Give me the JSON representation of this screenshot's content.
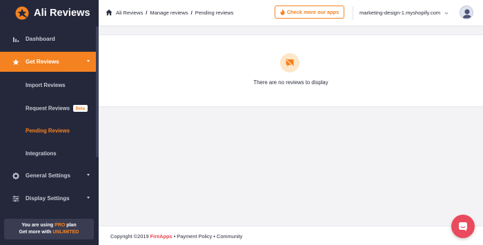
{
  "app": {
    "name": "Ali Reviews"
  },
  "sidebar": {
    "items": [
      {
        "label": "Dashboard"
      },
      {
        "label": "Get Reviews"
      },
      {
        "label": "General Settings"
      },
      {
        "label": "Display Settings"
      }
    ],
    "sub_items": [
      {
        "label": "Import Reviews"
      },
      {
        "label": "Request Reviews",
        "badge": "Beta"
      },
      {
        "label": "Pending Reviews"
      },
      {
        "label": "Integrations"
      }
    ],
    "plan": {
      "line1_prefix": "You are using ",
      "line1_plan": "PRO",
      "line1_suffix": " plan",
      "line2_prefix": "Get more with ",
      "line2_highlight": "UNLIMITED"
    }
  },
  "header": {
    "breadcrumb": [
      "Ali Reviews",
      "Manage reviews",
      "Pending reviews"
    ],
    "separator": "/",
    "check_apps_label": "Check more our apps",
    "store_name": "marketing-design-1.myshopify.com"
  },
  "main": {
    "empty_message": "There are no reviews to display"
  },
  "footer": {
    "copyright": "Copyright ©2019 ",
    "brand": "FireApps",
    "links": " • Payment Policy • Community"
  },
  "colors": {
    "accent": "#f58220",
    "sidebar_bg": "#25283b",
    "chat": "#ea4a5d"
  },
  "icons": [
    "star-logo-icon",
    "bar-chart-icon",
    "star-icon",
    "gear-icon",
    "sliders-icon",
    "home-icon",
    "fire-icon",
    "chevron-down-icon",
    "user-avatar-icon",
    "no-reviews-icon",
    "chat-icon"
  ]
}
